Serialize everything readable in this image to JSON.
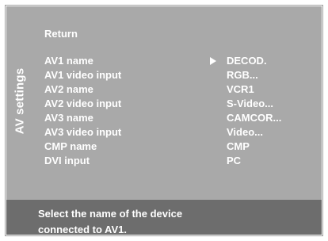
{
  "menu": {
    "side_title": "AV settings",
    "return_label": "Return",
    "items": [
      {
        "label": "AV1 name",
        "value": "DECOD.",
        "selected": true
      },
      {
        "label": "AV1 video input",
        "value": "RGB..."
      },
      {
        "label": "AV2 name",
        "value": "VCR1"
      },
      {
        "label": "AV2 video input",
        "value": "S-Video..."
      },
      {
        "label": "AV3 name",
        "value": "CAMCOR..."
      },
      {
        "label": "AV3 video input",
        "value": "Video..."
      },
      {
        "label": "CMP name",
        "value": "CMP"
      },
      {
        "label": "DVI input",
        "value": "PC"
      }
    ]
  },
  "help": {
    "line1": "Select the name of the device",
    "line2": "connected to AV1."
  },
  "colors": {
    "panel": "#a9a9a9",
    "footer": "#6d6d6d",
    "text": "#ffffff"
  },
  "icons": {
    "selection_marker": "right-triangle-icon"
  }
}
